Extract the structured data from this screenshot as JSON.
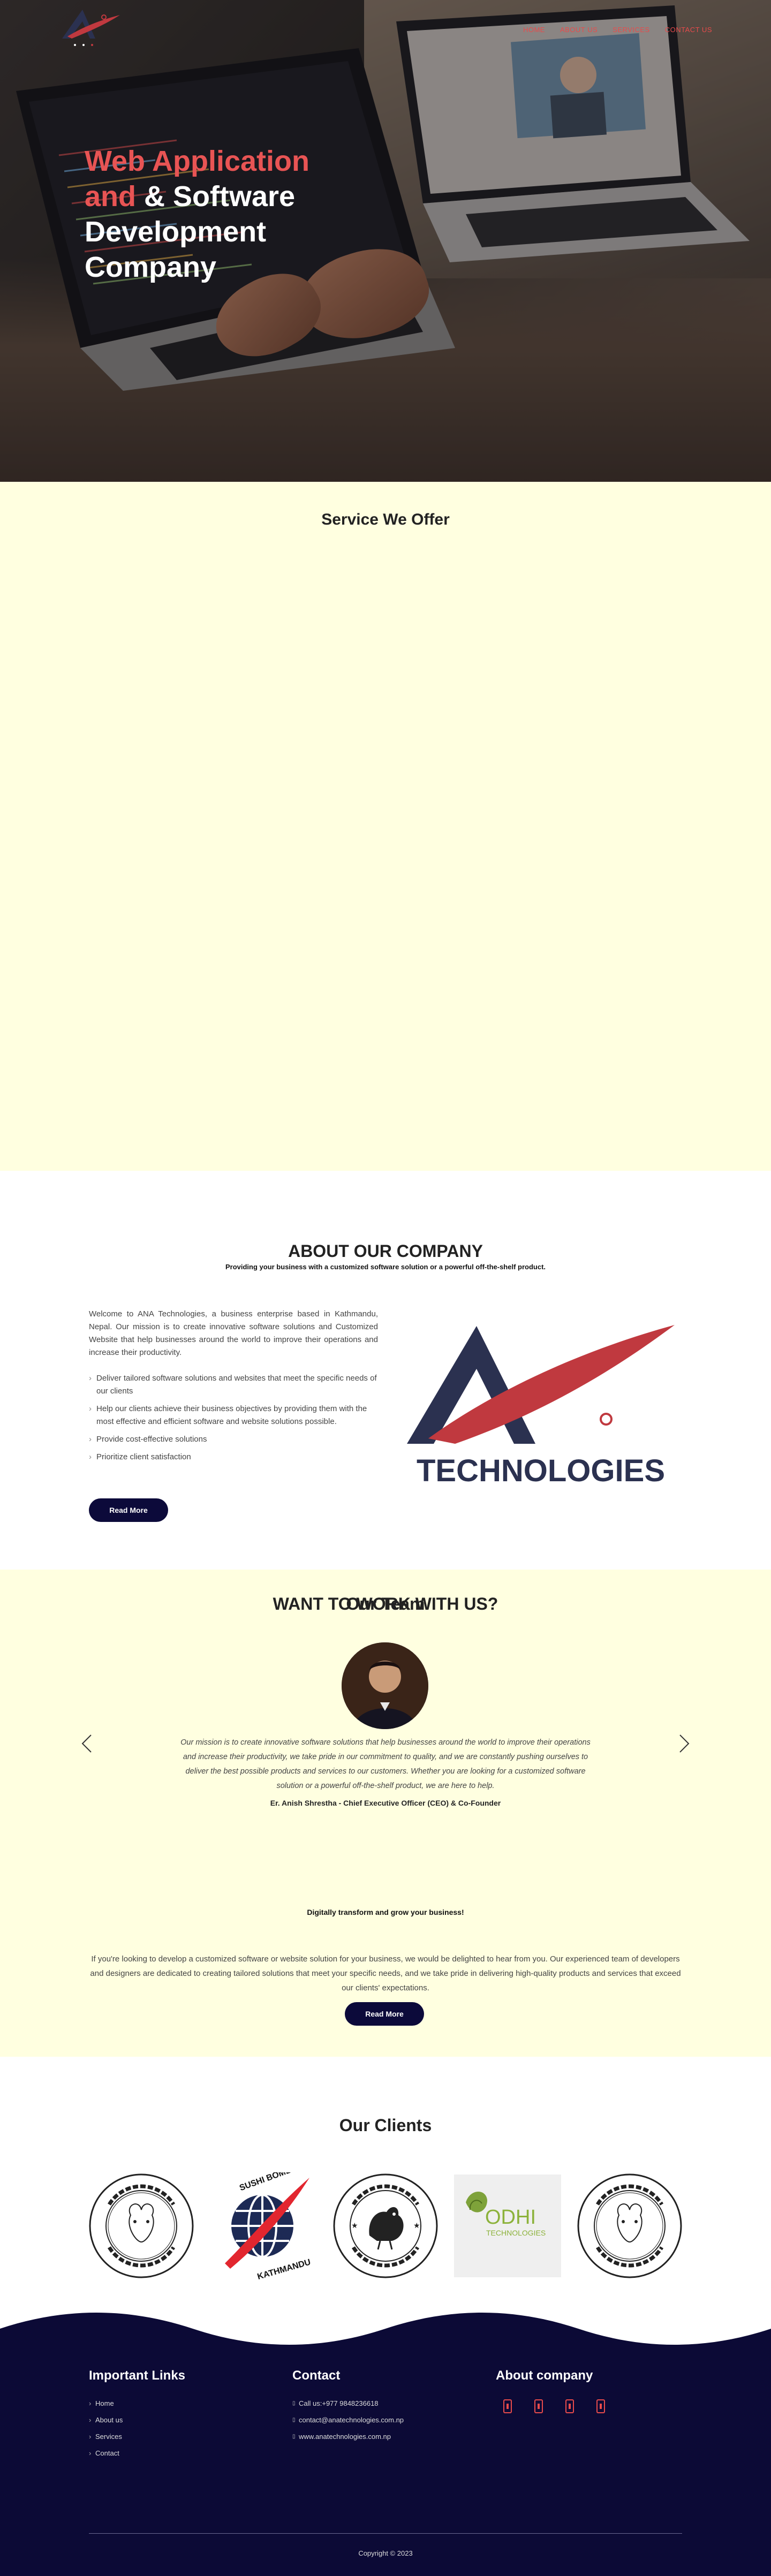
{
  "nav": {
    "links": [
      "HOME",
      "ABOUT US",
      "SERVICES",
      "CONTACT US"
    ],
    "accent_color": "#e84b4b"
  },
  "hero": {
    "title_line1": "Web Application",
    "title_line2_accent": "and",
    "title_line2_rest": " & Software",
    "title_line3": "Development",
    "title_line4": "Company"
  },
  "services": {
    "title": "Service We Offer"
  },
  "about": {
    "title": "ABOUT OUR COMPANY",
    "subtitle": "Providing your business with a customized software solution or a powerful off-the-shelf product.",
    "paragraph": "Welcome to ANA Technologies, a business enterprise based in Kathmandu, Nepal. Our mission is to create innovative software solutions and Customized Website that help businesses around the world to improve their operations and increase their productivity.",
    "list": [
      "Deliver tailored software solutions and websites that meet the specific needs of our clients",
      "Help our clients achieve their business objectives by providing them with the most effective and efficient software and website solutions possible.",
      "Provide cost-effective solutions",
      "Prioritize client satisfaction"
    ],
    "button": "Read More",
    "logo_text": "TECHNOLOGIES"
  },
  "team": {
    "title": "Our Team",
    "quote": "Our mission is to create innovative software solutions that help businesses around the world to improve their operations and increase their productivity, we take pride in our commitment to quality, and we are constantly pushing ourselves to deliver the best possible products and services to our customers. Whether you are looking for a customized software solution or a powerful off-the-shelf product, we are here to help.",
    "person": "Er. Anish Shrestha - Chief Executive Officer (CEO) & Co-Founder"
  },
  "work": {
    "title": "WANT TO WORK WITH US?",
    "subtitle": "Digitally transform and grow your business!",
    "text": "If you're looking to develop a customized software or website solution for your business, we would be delighted to hear from you. Our experienced team of developers and designers are dedicated to creating tailored solutions that meet your specific needs, and we take pride in delivering high-quality products and services that exceed our clients' expectations.",
    "button": "Read More"
  },
  "clients": {
    "title": "Our Clients",
    "bomber_top": "SUSHI BOMBER",
    "bomber_bottom": "KATHMANDU",
    "bodhi_text": "ODHI",
    "bodhi_sub": "TECHNOLOGIES"
  },
  "footer": {
    "links_title": "Important Links",
    "links": [
      "Home",
      "About us",
      "Services",
      "Contact"
    ],
    "contact_title": "Contact",
    "contact": [
      "Call us:+977 9848236618",
      "contact@anatechnologies.com.np",
      "www.anatechnologies.com.np"
    ],
    "about_title": "About company",
    "copyright": "Copyright © 2023"
  },
  "colors": {
    "navy": "#0c0a36",
    "red": "#e84b4b",
    "cream": "#ffffe0"
  }
}
